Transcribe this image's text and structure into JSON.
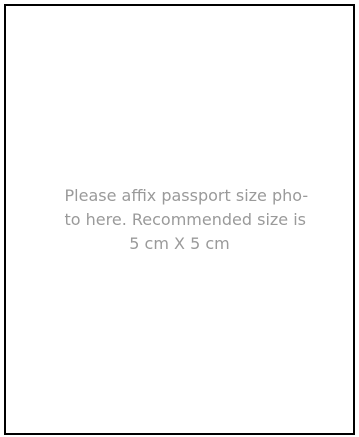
{
  "photo_box": {
    "instruction_lines": [
      "Please affix passport size pho-",
      "to here. Recommended size is",
      "5 cm X 5 cm"
    ]
  },
  "colors": {
    "border": "#000000",
    "text": "#9a9a9a",
    "background": "#ffffff"
  }
}
